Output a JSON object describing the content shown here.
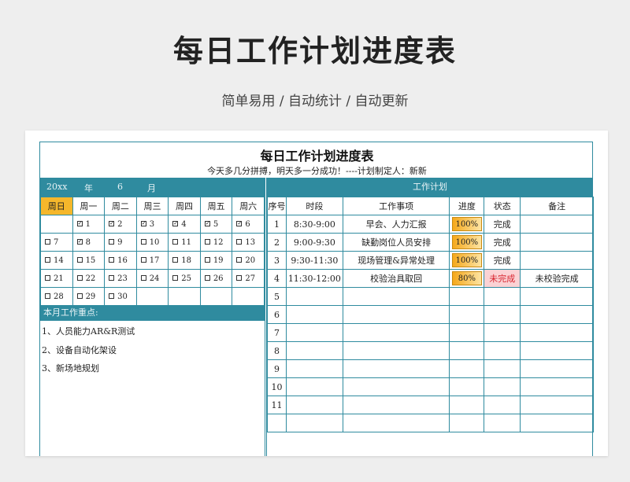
{
  "header": {
    "title": "每日工作计划进度表",
    "subtitle": "简单易用  /  自动统计  /  自动更新"
  },
  "sheet": {
    "title": "每日工作计划进度表",
    "motto": "今天多几分拼搏，明天多一分成功！----计划制定人：新新"
  },
  "calendar": {
    "year_value": "20xx",
    "year_label": "年",
    "month_value": "6",
    "month_label": "月",
    "weekdays": [
      "周日",
      "周一",
      "周二",
      "周三",
      "周四",
      "周五",
      "周六"
    ],
    "weeks": [
      [
        null,
        {
          "d": "1",
          "c": true
        },
        {
          "d": "2",
          "c": true
        },
        {
          "d": "3",
          "c": true
        },
        {
          "d": "4",
          "c": true
        },
        {
          "d": "5",
          "c": true
        },
        {
          "d": "6",
          "c": true
        }
      ],
      [
        {
          "d": "7",
          "c": false
        },
        {
          "d": "8",
          "c": true
        },
        {
          "d": "9",
          "c": false
        },
        {
          "d": "10",
          "c": false
        },
        {
          "d": "11",
          "c": false
        },
        {
          "d": "12",
          "c": false
        },
        {
          "d": "13",
          "c": false
        }
      ],
      [
        {
          "d": "14",
          "c": false
        },
        {
          "d": "15",
          "c": false
        },
        {
          "d": "16",
          "c": false
        },
        {
          "d": "17",
          "c": false
        },
        {
          "d": "18",
          "c": false
        },
        {
          "d": "19",
          "c": false
        },
        {
          "d": "20",
          "c": false
        }
      ],
      [
        {
          "d": "21",
          "c": false
        },
        {
          "d": "22",
          "c": false
        },
        {
          "d": "23",
          "c": false
        },
        {
          "d": "24",
          "c": false
        },
        {
          "d": "25",
          "c": false
        },
        {
          "d": "26",
          "c": false
        },
        {
          "d": "27",
          "c": false
        }
      ],
      [
        {
          "d": "28",
          "c": false
        },
        {
          "d": "29",
          "c": false
        },
        {
          "d": "30",
          "c": false
        },
        null,
        null,
        null,
        null
      ]
    ]
  },
  "focus": {
    "label": "本月工作重点:",
    "items": [
      "1、人员能力AR&R测试",
      "2、设备自动化架设",
      "3、新场地规划"
    ]
  },
  "plan": {
    "label": "工作计划",
    "columns": [
      "序号",
      "时段",
      "工作事项",
      "进度",
      "状态",
      "备注"
    ],
    "rows": [
      {
        "no": "1",
        "time": "8:30-9:00",
        "task": "早会、人力汇报",
        "progress": "100%",
        "status": "完成",
        "note": ""
      },
      {
        "no": "2",
        "time": "9:00-9:30",
        "task": "缺勤岗位人员安排",
        "progress": "100%",
        "status": "完成",
        "note": ""
      },
      {
        "no": "3",
        "time": "9:30-11:30",
        "task": "现场管理&异常处理",
        "progress": "100%",
        "status": "完成",
        "note": ""
      },
      {
        "no": "4",
        "time": "11:30-12:00",
        "task": "校验治具取回",
        "progress": "80%",
        "status": "未完成",
        "note": "未校验完成"
      },
      {
        "no": "5",
        "time": "",
        "task": "",
        "progress": "",
        "status": "",
        "note": ""
      },
      {
        "no": "6",
        "time": "",
        "task": "",
        "progress": "",
        "status": "",
        "note": ""
      },
      {
        "no": "7",
        "time": "",
        "task": "",
        "progress": "",
        "status": "",
        "note": ""
      },
      {
        "no": "8",
        "time": "",
        "task": "",
        "progress": "",
        "status": "",
        "note": ""
      },
      {
        "no": "9",
        "time": "",
        "task": "",
        "progress": "",
        "status": "",
        "note": ""
      },
      {
        "no": "10",
        "time": "",
        "task": "",
        "progress": "",
        "status": "",
        "note": ""
      },
      {
        "no": "11",
        "time": "",
        "task": "",
        "progress": "",
        "status": "",
        "note": ""
      },
      {
        "no": "",
        "time": "",
        "task": "",
        "progress": "",
        "status": "",
        "note": ""
      }
    ]
  },
  "colors": {
    "teal": "#2f8b9f",
    "sunday": "#f5b72b",
    "undone_bg": "#fbd2d4",
    "undone_text": "#d8242f"
  }
}
